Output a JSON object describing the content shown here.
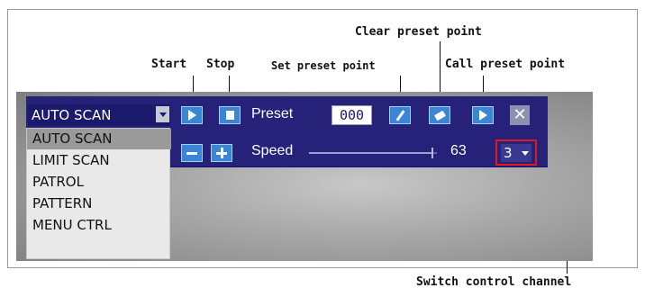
{
  "callouts": {
    "start": "Start",
    "stop": "Stop",
    "set_preset": "Set preset point",
    "clear_preset": "Clear preset point",
    "call_preset": "Call preset point",
    "switch_channel": "Switch control channel"
  },
  "toolbar": {
    "mode_selected": "AUTO SCAN",
    "preset_label": "Preset",
    "preset_value": "000",
    "speed_label": "Speed",
    "speed_value": "63",
    "channel_value": "3",
    "close_glyph": "✕"
  },
  "mode_options": [
    "AUTO SCAN",
    "LIMIT SCAN",
    "PATROL",
    "PATTERN",
    "MENU CTRL"
  ],
  "speed_level_fraction": 0.97,
  "colors": {
    "toolbar_bg": "#26227a",
    "button_blue": "#3a86d4",
    "highlight_red": "#e01818"
  },
  "icons": {
    "start": "play-icon",
    "stop": "stop-icon",
    "set_preset": "pencil-icon",
    "clear_preset": "eraser-icon",
    "call_preset": "play-icon",
    "speed_down": "minus-icon",
    "speed_up": "plus-icon",
    "close": "close-icon"
  }
}
